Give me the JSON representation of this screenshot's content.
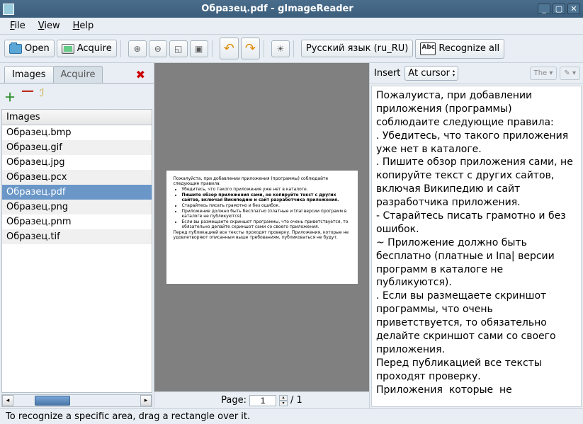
{
  "window": {
    "title": "Образец.pdf - gImageReader"
  },
  "menu": {
    "file": "File",
    "view": "View",
    "help": "Help"
  },
  "toolbar": {
    "open": "Open",
    "acquire": "Acquire",
    "language": "Русский язык (ru_RU)",
    "recognize_all": "Recognize all"
  },
  "sidebar": {
    "tab_images": "Images",
    "tab_acquire": "Acquire",
    "list_header": "Images",
    "files": [
      "Образец.bmp",
      "Образец.gif",
      "Образец.jpg",
      "Образец.pcx",
      "Образец.pdf",
      "Образец.png",
      "Образец.pnm",
      "Образец.tif"
    ],
    "selected_index": 4
  },
  "document": {
    "page_label": "Page:",
    "page_current": "1",
    "page_total": "/ 1",
    "preview_lines": {
      "intro": "Пожалуйста, при добавлении приложения (программы) соблюдайте следующие правила:",
      "b1": "Убедитесь, что такого приложения уже нет в каталоге.",
      "b2": "Пишите обзор приложения сами, не копируйте текст с других сайтов, включая Википедию и сайт разработчика приложения.",
      "b3": "Старайтесь писать грамотно и без ошибок.",
      "b4": "Приложение должно быть бесплатно (платные и trial версии программ в каталоге не публикуются).",
      "b5": "Если вы размещаете скриншот программы, что очень приветствуется, то обязательно делайте скриншот сами со своего приложения.",
      "outro": "Перед публикацией все тексты проходят проверку. Приложения, которые не удовлетворяют описанным выше требованиям, публиковаться не будут."
    }
  },
  "output": {
    "insert_label": "Insert",
    "insert_mode": "At cursor",
    "the_btn": "The",
    "text": "Пожалуиста, при добавлении приложения (программы) соблюдаите следующие правила:\n. Убедитесь, что такого приложения уже нет в каталоге.\n. Пишите обзор приложения сами, не копируйте текст с других сайтов, включая Википедию и сайт разработчика приложения.\n- Старайтесь писать грамотно и без ошибок.\n~ Приложение должно быть бесплатно (платные и Iпа| версии программ в каталоге не публикуются).\n. Если вы размещаете скриншот программы, что очень приветствуется, то обязательно делайте скриншот сами со своего приложения.\nПеред публикацией все тексты проходят проверку.\nПриложения  которые  не"
  },
  "statusbar": {
    "text": "To recognize a specific area, drag a rectangle over it."
  }
}
